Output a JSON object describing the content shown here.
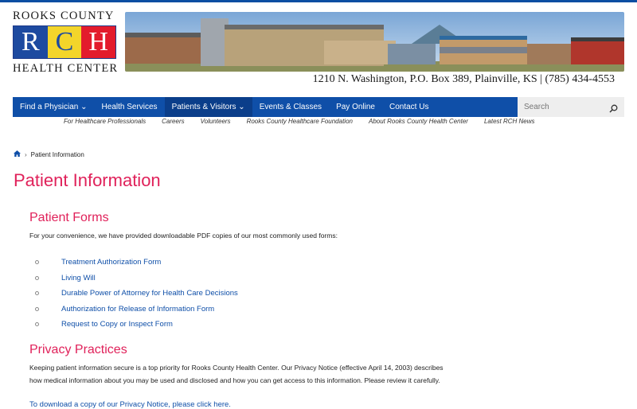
{
  "logo": {
    "top": "ROOKS COUNTY",
    "letters": [
      "R",
      "C",
      "H"
    ],
    "bottom": "HEALTH CENTER"
  },
  "address": "1210 N. Washington, P.O. Box 389, Plainville, KS | (785) 434-4553",
  "nav": {
    "items": [
      {
        "label": "Find a Physician ⌄"
      },
      {
        "label": "Health Services"
      },
      {
        "label": "Patients & Visitors ⌄"
      },
      {
        "label": "Events & Classes"
      },
      {
        "label": "Pay Online"
      },
      {
        "label": "Contact Us"
      }
    ],
    "active_index": 2
  },
  "search": {
    "placeholder": "Search"
  },
  "subnav": [
    "For Healthcare Professionals",
    "Careers",
    "Volunteers",
    "Rooks County Healthcare Foundation",
    "About Rooks County Health Center",
    "Latest RCH News"
  ],
  "breadcrumb": {
    "current": "Patient Information"
  },
  "page_title": "Patient Information",
  "forms_section": {
    "heading": "Patient Forms",
    "intro": "For your convenience, we have provided downloadable PDF copies of our most commonly used forms:",
    "items": [
      "Treatment Authorization Form",
      "Living Will",
      "Durable Power of Attorney for Health Care Decisions",
      "Authorization for Release of Information Form",
      "Request to Copy or Inspect Form"
    ]
  },
  "privacy_section": {
    "heading": "Privacy Practices",
    "text_1": "Keeping patient information secure is a top priority for Rooks County Health Center. Our Privacy Notice (effective April 14, 2003) describes",
    "text_2": "how medical information about you may be used and disclosed and how you can get access to this information. Please review it carefully.",
    "link": "To download a copy of our Privacy Notice, please click here."
  },
  "colors": {
    "nav_blue": "#0f4fa8",
    "heading_pink": "#e0215a",
    "link_blue": "#0f4fa8"
  }
}
